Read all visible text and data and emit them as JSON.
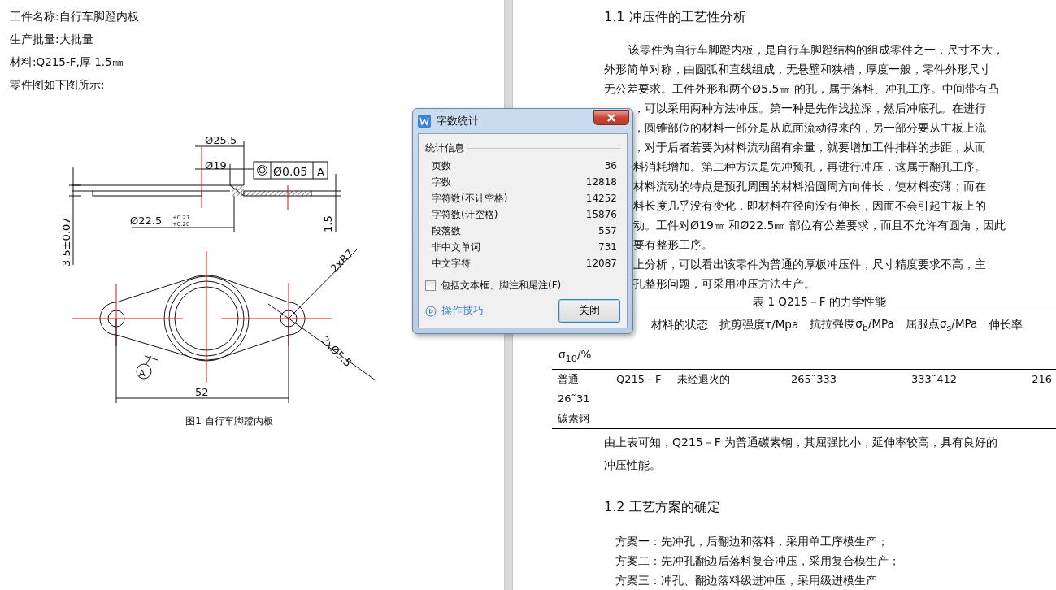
{
  "left_page": {
    "lines": [
      "工件名称:自行车脚蹬内板",
      "生产批量:大批量",
      "材料:Q215-F,厚 1.5㎜",
      "零件图如下图所示:"
    ],
    "drawing": {
      "labels": [
        "Ø25.5",
        "Ø19",
        "Ø0.05",
        "A",
        "Ø22.5",
        "+0.27",
        "+0.20",
        "3.5±0.07",
        "1.5",
        "2xR7",
        "2xØ5.5",
        "52",
        "A"
      ]
    },
    "caption": "图1  自行车脚蹬内板"
  },
  "right_page": {
    "heading": "1.1 冲压件的工艺性分析",
    "paragraph_lines": [
      {
        "text": "该零件为自行车脚蹬内板，是自行车脚蹬结构的组成零件之一，尺寸不大，",
        "covered": false,
        "first": true
      },
      {
        "text": "外形简单对称，由圆弧和直线组成，无悬壁和狭槽，厚度一般，零件外形尺寸",
        "covered": false,
        "first": false
      },
      {
        "text": "无公差要求。工件外形和两个Ø5.5㎜ 的孔，属于落料、冲孔工序。中间带有凸",
        "covered": false,
        "first": false
      },
      {
        "text": "，可以采用两种方法冲压。第一种是先作浅拉深，然后冲底孔。在进行",
        "covered": true,
        "first": false
      },
      {
        "text": "，圆锥部位的材料一部分是从底面流动得来的，另一部分要从主板上流",
        "covered": true,
        "first": false
      },
      {
        "text": "，对于后者若要为材料流动留有余量，就要增加工件排样的步距，从而",
        "covered": true,
        "first": false
      },
      {
        "text": "料消耗增加。第二种方法是先冲预孔，再进行冲压，这属于翻孔工序。",
        "covered": true,
        "first": false
      },
      {
        "text": "材料流动的特点是预孔周围的材料沿圆周方向伸长，使材料变薄；而在",
        "covered": true,
        "first": false
      },
      {
        "text": "料长度几乎没有变化，即材料在径向没有伸长，因而不会引起主板上的",
        "covered": true,
        "first": false
      },
      {
        "text": "动。工件对Ø19㎜ 和Ø22.5㎜ 部位有公差要求，而且不允许有圆角，因此",
        "covered": true,
        "first": false
      },
      {
        "text": "要有整形工序。",
        "covered": true,
        "first": false
      },
      {
        "text": "上分析，可以看出该零件为普通的厚板冲压件，尺寸精度要求不高，主",
        "covered": true,
        "first": false
      },
      {
        "text": "孔整形问题，可采用冲压方法生产。",
        "covered": true,
        "first": false
      }
    ],
    "table": {
      "caption": "表 1 Q215－F 的力学性能",
      "header_lines": [
        [
          "材料的状态",
          "抗剪强度τ/Mpa",
          "抗拉强度σ$_{b}$/MPa",
          "屈服点σ$_{s}$/MPa",
          "伸长率"
        ],
        [
          "σ$_{10}$/%"
        ]
      ],
      "body_lines": [
        [
          "普通",
          "Q215－F",
          "未经退火的",
          "265˜333",
          "333˜412",
          "216"
        ],
        [
          "26˜31"
        ],
        [
          "碳素钢"
        ]
      ]
    },
    "after_table_lines": [
      "由上表可知，Q215－F 为普通碳素钢，其屈强比小，延伸率较高，具有良好的",
      "冲压性能。"
    ],
    "heading_2": "1.2 工艺方案的确定",
    "options": [
      "方案一：先冲孔，后翻边和落料，采用单工序模生产；",
      "方案二：先冲孔翻边后落料复合冲压，采用复合模生产；",
      "方案三：冲孔、翻边落料级进冲压，采用级进模生产"
    ]
  },
  "dialog": {
    "title": "字数统计",
    "section": "统计信息",
    "stats": [
      {
        "label": "页数",
        "value": "36"
      },
      {
        "label": "字数",
        "value": "12818"
      },
      {
        "label": "字符数(不计空格)",
        "value": "14252"
      },
      {
        "label": "字符数(计空格)",
        "value": "15876"
      },
      {
        "label": "段落数",
        "value": "557"
      },
      {
        "label": "非中文单词",
        "value": "731"
      },
      {
        "label": "中文字符",
        "value": "12087"
      }
    ],
    "checkbox": {
      "label": "包括文本框、脚注和尾注(F)",
      "checked": false
    },
    "tips_link": "操作技巧",
    "close_button": "关闭"
  }
}
